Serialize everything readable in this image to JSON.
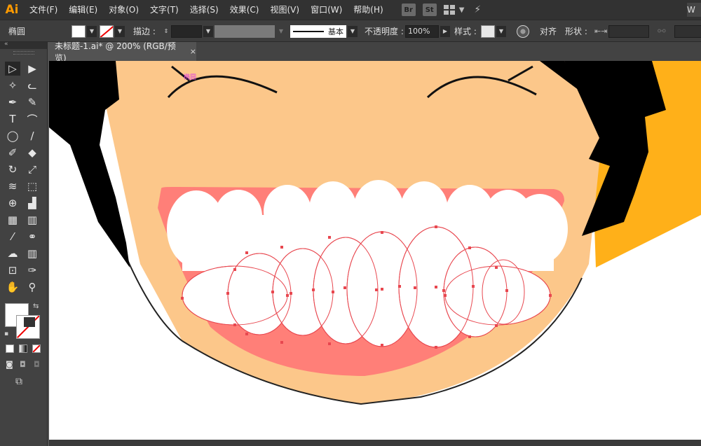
{
  "app": {
    "logo": "Ai"
  },
  "menu": [
    "文件(F)",
    "编辑(E)",
    "对象(O)",
    "文字(T)",
    "选择(S)",
    "效果(C)",
    "视图(V)",
    "窗口(W)",
    "帮助(H)"
  ],
  "menu_icons": {
    "bridge": "Br",
    "stock": "St",
    "right_edge": "W"
  },
  "control": {
    "tool_name": "椭圆",
    "stroke_label": "描边 :",
    "stroke_style": "基本",
    "opacity_label": "不透明度 :",
    "opacity_value": "100%",
    "style_label": "样式 :",
    "align_label": "对齐",
    "shape_label": "形状 :"
  },
  "document": {
    "tab_title": "未标题-1.ai* @ 200% (RGB/预览)",
    "close": "×"
  },
  "tools": [
    {
      "name": "selection-tool-icon",
      "glyph": "▷"
    },
    {
      "name": "direct-selection-tool-icon",
      "glyph": "▶"
    },
    {
      "name": "magic-wand-tool-icon",
      "glyph": "✧"
    },
    {
      "name": "lasso-tool-icon",
      "glyph": "ᓚ"
    },
    {
      "name": "pen-tool-icon",
      "glyph": "✒"
    },
    {
      "name": "curvature-tool-icon",
      "glyph": "✎"
    },
    {
      "name": "type-tool-icon",
      "glyph": "T"
    },
    {
      "name": "arc-tool-icon",
      "glyph": "⌒"
    },
    {
      "name": "ellipse-tool-icon",
      "glyph": "◯"
    },
    {
      "name": "paintbrush-tool-icon",
      "glyph": "∕"
    },
    {
      "name": "shaper-tool-icon",
      "glyph": "✐"
    },
    {
      "name": "eraser-tool-icon",
      "glyph": "◆"
    },
    {
      "name": "rotate-tool-icon",
      "glyph": "↻"
    },
    {
      "name": "scale-tool-icon",
      "glyph": "⤢"
    },
    {
      "name": "warp-tool-icon",
      "glyph": "≋"
    },
    {
      "name": "free-transform-tool-icon",
      "glyph": "⬚"
    },
    {
      "name": "shape-builder-tool-icon",
      "glyph": "⊕"
    },
    {
      "name": "perspective-grid-tool-icon",
      "glyph": "▟"
    },
    {
      "name": "mesh-tool-icon",
      "glyph": "▦"
    },
    {
      "name": "gradient-tool-icon",
      "glyph": "▥"
    },
    {
      "name": "eyedropper-tool-icon",
      "glyph": "⁄"
    },
    {
      "name": "blend-tool-icon",
      "glyph": "⚭"
    },
    {
      "name": "symbol-sprayer-tool-icon",
      "glyph": "☁"
    },
    {
      "name": "column-graph-tool-icon",
      "glyph": "▥"
    },
    {
      "name": "artboard-tool-icon",
      "glyph": "⊡"
    },
    {
      "name": "slice-tool-icon",
      "glyph": "✑"
    },
    {
      "name": "hand-tool-icon",
      "glyph": "✋"
    },
    {
      "name": "zoom-tool-icon",
      "glyph": "⚲"
    }
  ],
  "colors": {
    "skin": "#fcc78a",
    "hair": "#000000",
    "hat": "#ffb019",
    "gum": "#ff7f78",
    "teeth": "#ffffff",
    "path": "#e8474f",
    "anchor": "#e8474f",
    "label": "#e040e0"
  },
  "artwork_label": "椭圆"
}
